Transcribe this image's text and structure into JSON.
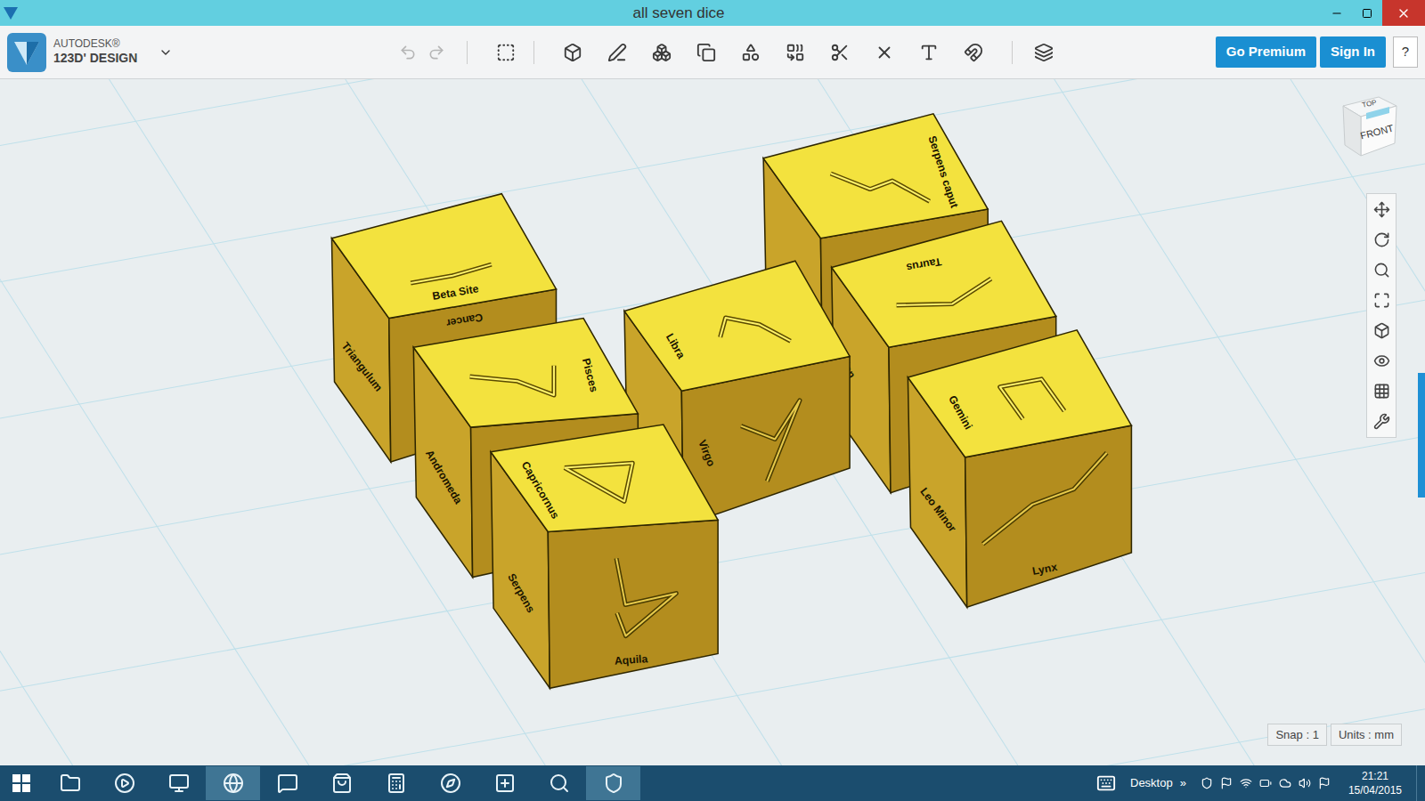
{
  "window": {
    "title": "all seven dice"
  },
  "app": {
    "vendor": "AUTODESK®",
    "product": "123D' DESIGN"
  },
  "toolbar": {
    "undo_disabled": true,
    "redo_disabled": true
  },
  "account_buttons": [
    "Go Premium",
    "Sign In"
  ],
  "help": "?",
  "view_cube": {
    "top": "TOP",
    "front": "FRONT"
  },
  "dice": [
    {
      "top": "Serpens caput"
    },
    {
      "top": "Beta Site",
      "front": "Cancer",
      "left": "Triangulum"
    },
    {
      "top": "Taurus",
      "left": "Orion"
    },
    {
      "top": "Libra",
      "front": "Virgo"
    },
    {
      "top": "Pisces",
      "left": "Andromeda"
    },
    {
      "top": "Gemini",
      "front": "Lynx",
      "left": "Leo Minor"
    },
    {
      "top": "Capricornus",
      "front": "Aquila",
      "left": "Serpens"
    }
  ],
  "status": {
    "snap": "Snap : 1",
    "units": "Units : mm"
  },
  "taskbar": {
    "desktop": "Desktop",
    "overflow": "»",
    "time": "21:21",
    "date": "15/04/2015"
  }
}
